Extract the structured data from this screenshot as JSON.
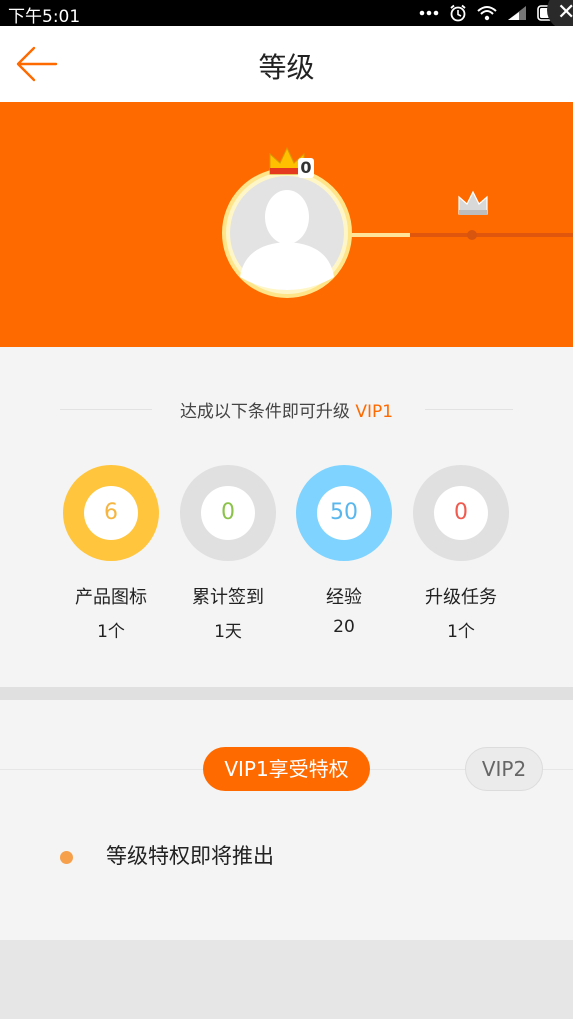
{
  "status_bar": {
    "time": "下午5:01",
    "icons": [
      "more-dots-icon",
      "alarm-icon",
      "wifi-icon",
      "signal-icon",
      "battery-icon"
    ]
  },
  "header": {
    "title": "等级",
    "back_icon": "back-arrow-icon"
  },
  "hero": {
    "current_level": "0",
    "avatar": "default-avatar",
    "background_color": "#ff6a00"
  },
  "conditions": {
    "title_prefix": "达成以下条件即可升级 ",
    "title_vip": "VIP1",
    "items": [
      {
        "value": "6",
        "label": "产品图标",
        "requirement": "1个",
        "ring_color": "#ffc53d",
        "text_color": "#f5b540"
      },
      {
        "value": "0",
        "label": "累计签到",
        "requirement": "1天",
        "ring_color": "#e0e0e0",
        "text_color": "#8bc34a"
      },
      {
        "value": "50",
        "label": "经验",
        "requirement": "20",
        "ring_color": "#7fd3ff",
        "text_color": "#5ab7ee"
      },
      {
        "value": "0",
        "label": "升级任务",
        "requirement": "1个",
        "ring_color": "#e0e0e0",
        "text_color": "#f05a4f"
      }
    ]
  },
  "privileges": {
    "tabs": [
      "VIP1享受特权",
      "VIP2"
    ],
    "active_tab": "VIP1享受特权",
    "items": [
      "等级特权即将推出"
    ]
  },
  "colors": {
    "accent": "#ff6a00"
  }
}
